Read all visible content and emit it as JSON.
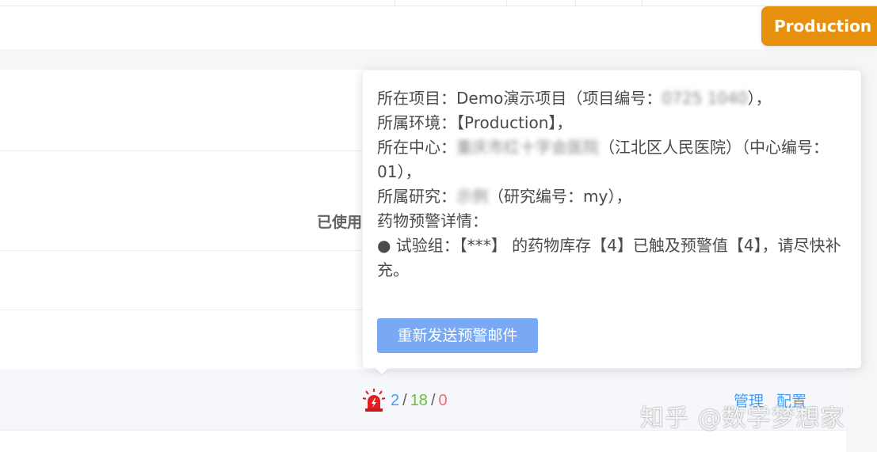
{
  "header": {
    "environment_badge": "Production"
  },
  "row": {
    "used_label": "已使用",
    "counts": {
      "first": "2",
      "separator": "/",
      "second": "18",
      "third": "0"
    },
    "actions": {
      "manage": "管理",
      "configure": "配置"
    }
  },
  "popover": {
    "project_prefix": "所在项目：Demo演示项目（项目编号：",
    "project_code_masked": "0725 1040",
    "project_suffix": "），",
    "environment_line": "所属环境：【Production】，",
    "center_prefix": "所在中心：",
    "center_masked": "重庆市红十字会医院",
    "center_suffix": "（江北区人民医院）（中心编号：01），",
    "study_prefix": "所属研究：",
    "study_masked": "示例",
    "study_suffix": "（研究编号：my），",
    "details_label": "药物预警详情：",
    "detail_item": "● 试验组：【***】 的药物库存【4】已触及预警值【4】，请尽快补充。",
    "resend_button": "重新发送预警邮件"
  },
  "watermark": "知乎 @数学梦想家",
  "colors": {
    "badge_bg": "#e6900d",
    "button_bg": "#79a9f5",
    "count_blue": "#409eff",
    "count_green": "#67c23a",
    "count_red": "#f56c6c",
    "link_blue": "#409eff"
  },
  "icons": {
    "alarm": "alarm-siren-icon"
  }
}
